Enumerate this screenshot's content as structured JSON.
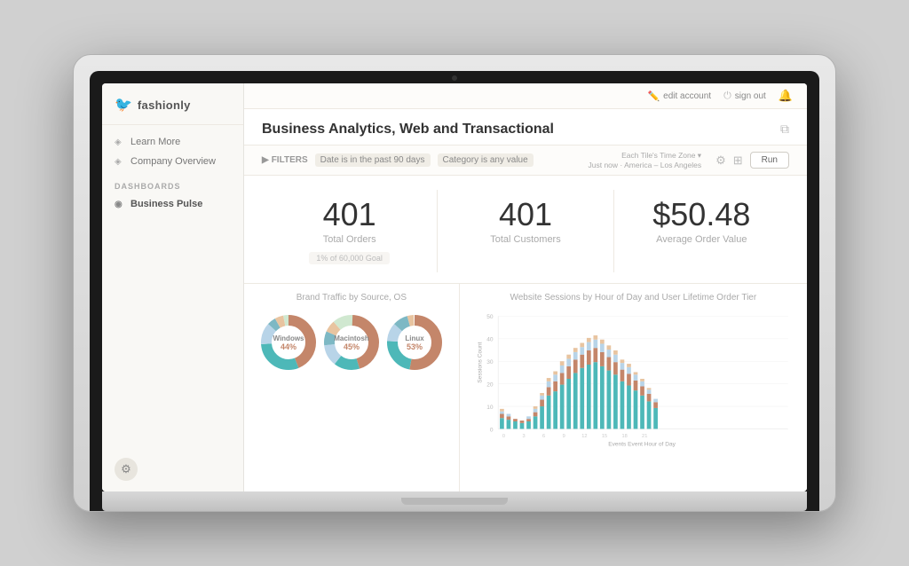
{
  "logo": {
    "brand": "fashionly",
    "icon": "🐦"
  },
  "topbar": {
    "edit_account": "edit account",
    "sign_out": "sign out"
  },
  "sidebar": {
    "nav": [
      {
        "label": "Learn More",
        "icon": "◈"
      },
      {
        "label": "Company Overview",
        "icon": "◈"
      }
    ],
    "section_label": "DASHBOARDS",
    "dashboards": [
      {
        "label": "Business Pulse",
        "icon": "◉",
        "active": true
      }
    ]
  },
  "dashboard": {
    "title": "Business Analytics, Web and Transactional",
    "filters": {
      "label": "FILTERS",
      "items": [
        "Date is in the past 90 days",
        "Category is any value"
      ]
    },
    "timezone": {
      "line1": "Each Tile's Time Zone ▾",
      "line2": "Just now · America – Los Angeles"
    },
    "run_button": "Run"
  },
  "kpis": [
    {
      "value": "401",
      "label": "Total Orders",
      "sub": "1% of 60,000 Goal"
    },
    {
      "value": "401",
      "label": "Total Customers",
      "sub": null
    },
    {
      "value": "$50.48",
      "label": "Average Order Value",
      "sub": null
    }
  ],
  "brand_traffic": {
    "title": "Brand Traffic by Source, OS",
    "donuts": [
      {
        "label": "Windows",
        "segments": [
          {
            "pct": 44,
            "color": "#c4866a"
          },
          {
            "pct": 30,
            "color": "#4db8b8"
          },
          {
            "pct": 13,
            "color": "#b8d4e8"
          },
          {
            "pct": 5,
            "color": "#7db8c4"
          },
          {
            "pct": 5,
            "color": "#e8c4a0"
          },
          {
            "pct": 3,
            "color": "#d0e8d0"
          }
        ],
        "center": "44%"
      },
      {
        "label": "Macintosh",
        "segments": [
          {
            "pct": 45,
            "color": "#c4866a"
          },
          {
            "pct": 15,
            "color": "#4db8b8"
          },
          {
            "pct": 13,
            "color": "#b8d4e8"
          },
          {
            "pct": 8,
            "color": "#7db8c4"
          },
          {
            "pct": 7,
            "color": "#e8c4a0"
          },
          {
            "pct": 12,
            "color": "#d0e8d0"
          }
        ],
        "center": "45%"
      },
      {
        "label": "Linux",
        "segments": [
          {
            "pct": 53,
            "color": "#c4866a"
          },
          {
            "pct": 23,
            "color": "#4db8b8"
          },
          {
            "pct": 11,
            "color": "#b8d4e8"
          },
          {
            "pct": 9,
            "color": "#7db8c4"
          },
          {
            "pct": 4,
            "color": "#e8c4a0"
          }
        ],
        "center": "53%"
      }
    ]
  },
  "sessions_chart": {
    "title": "Website Sessions by Hour of Day and User Lifetime Order Tier",
    "y_label": "Sessions Count",
    "x_label": "Events  Event Hour of Day",
    "y_ticks": [
      "0",
      "10",
      "20",
      "30",
      "40",
      "50"
    ],
    "colors": {
      "tier1": "#4db8b8",
      "tier2": "#c4866a",
      "tier3": "#b8d4e8",
      "tier4": "#e8c4a0"
    }
  },
  "gear_label": "⚙"
}
